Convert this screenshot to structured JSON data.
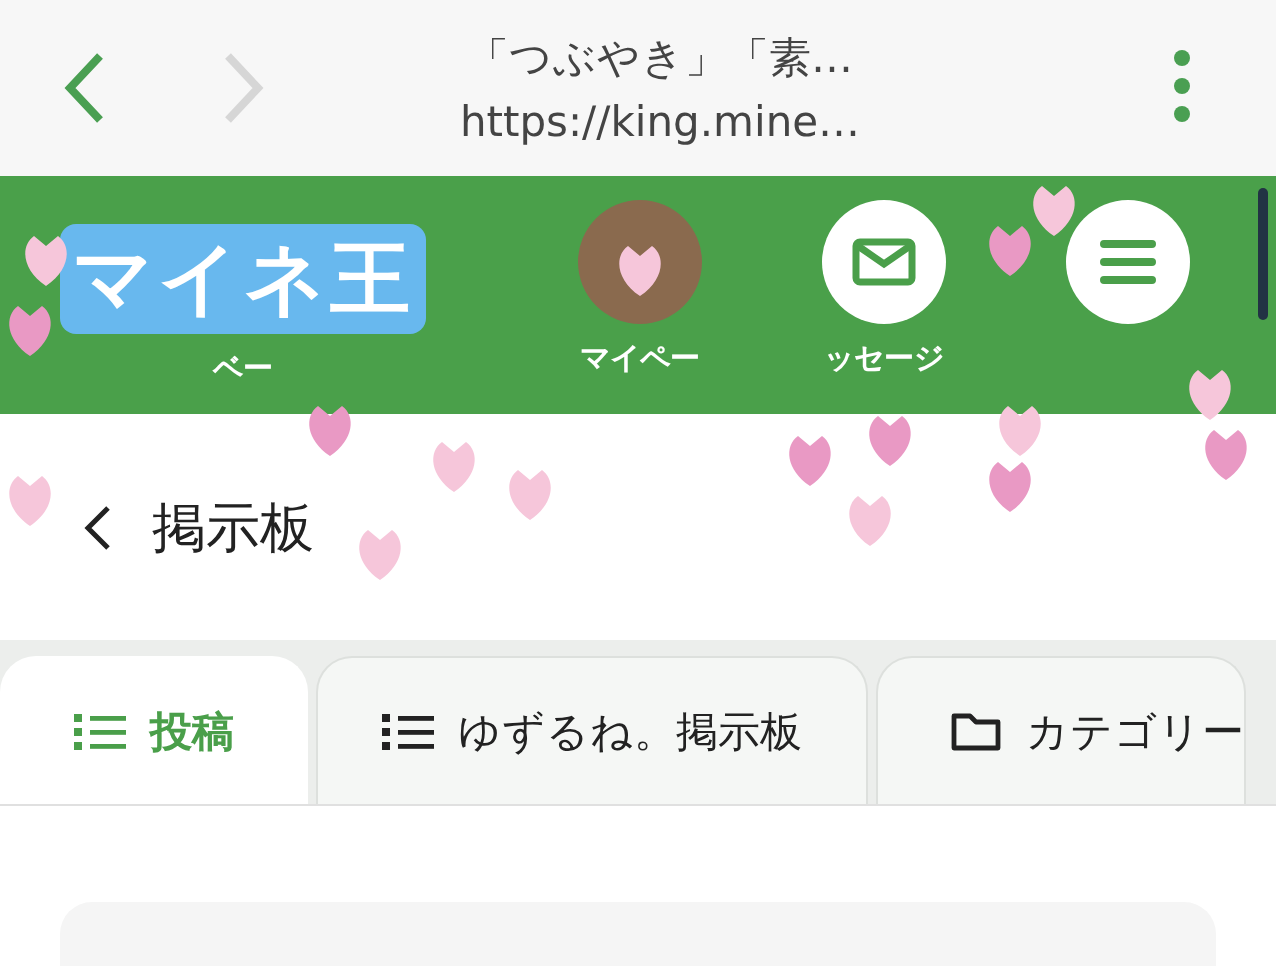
{
  "browser_bar": {
    "page_title": "「つぶやき」「素…",
    "url": "https://king.mine…"
  },
  "header": {
    "logo": "マイネ王",
    "logo_label": "ベー",
    "nav": [
      {
        "kind": "avatar",
        "label": "マイペー"
      },
      {
        "kind": "mail",
        "label": "ッセージ"
      },
      {
        "kind": "menu"
      }
    ]
  },
  "page": {
    "title": "掲示板"
  },
  "tabs": [
    {
      "kind": "list",
      "label": "投稿",
      "selected": true
    },
    {
      "kind": "list",
      "label": "ゆずるね。掲示板",
      "selected": false
    },
    {
      "kind": "folder",
      "label": "カテゴリー",
      "selected": false
    }
  ]
}
